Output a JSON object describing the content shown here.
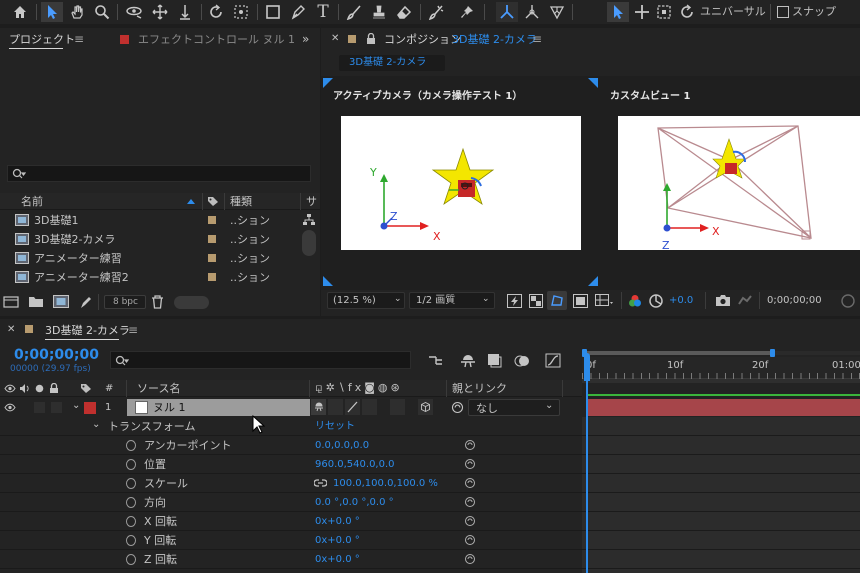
{
  "toolbar": {
    "universal_label": "ユニバーサル",
    "snap_label": "スナップ"
  },
  "project_panel": {
    "tab_label": "プロジェクト",
    "effects_tab_label": "エフェクトコントロール ヌル 1",
    "col_name": "名前",
    "col_type": "種類",
    "col_extra": "サ",
    "items": [
      {
        "name": "3D基礎1",
        "type": "..ション"
      },
      {
        "name": "3D基礎2-カメラ",
        "type": "..ション"
      },
      {
        "name": "アニメーター練習",
        "type": "..ション"
      },
      {
        "name": "アニメーター練習2",
        "type": "..ション"
      }
    ],
    "bpc_label": "8 bpc"
  },
  "comp_panel": {
    "tab_prefix": "コンポジション",
    "tab_name": "3D基礎 2-カメラ",
    "breadcrumb": "3D基礎 2-カメラ",
    "view_left_label": "アクティブカメラ（カメラ操作テスト 1）",
    "view_right_label": "カスタムビュー 1",
    "zoom": "(12.5 %)",
    "resolution": "1/2 画質",
    "exposure": "+0.0",
    "timecode": "0;00;00;00",
    "axis_x": "X",
    "axis_y": "Y",
    "axis_z": "Z"
  },
  "timeline": {
    "tab_label": "3D基礎 2-カメラ",
    "timecode": "0;00;00;00",
    "frames_fps": "00000 (29.97 fps)",
    "col_hash": "#",
    "col_source": "ソース名",
    "col_parent": "親とリンク",
    "layer": {
      "index": "1",
      "name": "ヌル 1",
      "parent": "なし"
    },
    "transform_label": "トランスフォーム",
    "reset_label": "リセット",
    "properties": [
      {
        "name": "アンカーポイント",
        "value": "0.0,0.0,0.0"
      },
      {
        "name": "位置",
        "value": "960.0,540.0,0.0"
      },
      {
        "name": "スケール",
        "value": "100.0,100.0,100.0 %"
      },
      {
        "name": "方向",
        "value": "0.0 °,0.0 °,0.0 °"
      },
      {
        "name": "X 回転",
        "value": "0x+0.0 °"
      },
      {
        "name": "Y 回転",
        "value": "0x+0.0 °"
      },
      {
        "name": "Z 回転",
        "value": "0x+0.0 °"
      }
    ],
    "ruler": [
      "0f",
      "10f",
      "20f",
      "01:00"
    ],
    "colors": {
      "accent": "#2d8ceb",
      "layer_bar": "#a6454a",
      "label_red": "#c0302e",
      "label_tan": "#b79b6f"
    }
  }
}
